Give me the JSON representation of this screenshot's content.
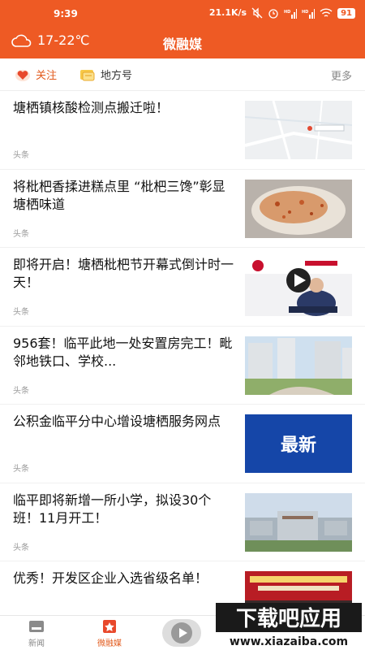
{
  "status_bar": {
    "time": "9:39",
    "network_speed": "21.1K/s",
    "battery": "91",
    "icons": [
      "mute-icon",
      "alarm-icon",
      "hd-signal-icon",
      "signal-icon",
      "hd-signal-icon",
      "signal-icon",
      "wifi-icon",
      "battery-icon"
    ]
  },
  "header": {
    "weather_icon": "cloud-icon",
    "weather": "17-22℃",
    "title": "微融媒",
    "accent": "#ee5a24"
  },
  "tabs": {
    "follow": {
      "label": "关注",
      "icon": "heart-icon"
    },
    "local": {
      "label": "地方号",
      "icon": "card-icon"
    },
    "more": "更多"
  },
  "news": [
    {
      "title": "塘栖镇核酸检测点搬迁啦！",
      "source": "头条",
      "thumb": "map-thumbnail"
    },
    {
      "title": "将枇杷香揉进糕点里  “枇杷三馋”彰显塘栖味道",
      "source": "头条",
      "thumb": "pastry-thumbnail"
    },
    {
      "title": "即将开启！塘栖枇杷节开幕式倒计时一天！",
      "source": "头条",
      "thumb": "video-thumbnail"
    },
    {
      "title": "956套！临平此地一处安置房完工！毗邻地铁口、学校...",
      "source": "头条",
      "thumb": "apartments-thumbnail"
    },
    {
      "title": "公积金临平分中心增设塘栖服务网点",
      "source": "头条",
      "thumb": "latest-banner-thumbnail",
      "thumb_text": "最新"
    },
    {
      "title": "临平即将新增一所小学，拟设30个班！11月开工！",
      "source": "头条",
      "thumb": "school-thumbnail"
    },
    {
      "title": "优秀！开发区企业入选省级名单！",
      "source": "",
      "thumb": "ceremony-thumbnail"
    }
  ],
  "bottom_nav": {
    "items": [
      {
        "label": "新闻",
        "icon": "news-icon"
      },
      {
        "label": "微融媒",
        "icon": "star-bookmark-icon"
      }
    ],
    "video_icon": "play-icon"
  },
  "watermark": {
    "title": "下载吧应用",
    "url": "www.xiazaiba.com"
  }
}
